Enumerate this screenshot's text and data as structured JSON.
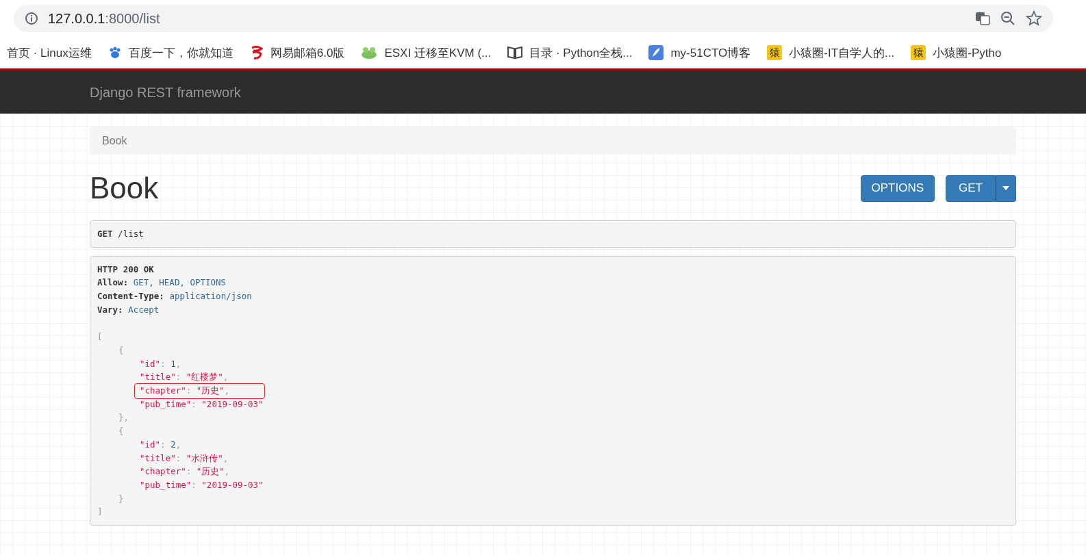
{
  "address_bar": {
    "host": "127.0.0.1",
    "path": ":8000/list"
  },
  "bookmarks": [
    {
      "label": "首页 · Linux运维",
      "kind": "plain"
    },
    {
      "label": "百度一下，你就知道",
      "kind": "paw"
    },
    {
      "label": "网易邮箱6.0版",
      "kind": "mail"
    },
    {
      "label": "ESXI 迁移至KVM (...",
      "kind": "frog"
    },
    {
      "label": "目录 · Python全栈...",
      "kind": "book"
    },
    {
      "label": "my-51CTO博客",
      "kind": "feather"
    },
    {
      "label": "小猿圈-IT自学人的...",
      "kind": "tile",
      "glyph": "猿"
    },
    {
      "label": "小猿圈-Pytho",
      "kind": "tile",
      "glyph": "猿"
    }
  ],
  "navbar": {
    "brand": "Django REST framework"
  },
  "breadcrumb": [
    "Book"
  ],
  "page_title": "Book",
  "buttons": [
    {
      "label": "OPTIONS",
      "kind": "plain"
    },
    {
      "label": "GET",
      "kind": "split"
    }
  ],
  "request": {
    "method": "GET",
    "path": "/list"
  },
  "response": {
    "status": "HTTP 200 OK",
    "headers": [
      {
        "name": "Allow:",
        "value": "GET, HEAD, OPTIONS"
      },
      {
        "name": "Content-Type:",
        "value": "application/json"
      },
      {
        "name": "Vary:",
        "value": "Accept"
      }
    ],
    "open_bracket": "[",
    "records": [
      {
        "open": "{",
        "close": "},",
        "fields": [
          {
            "key": "\"id\"",
            "sep": ":",
            "value": "1",
            "kind": "number",
            "end": ",",
            "highlighted": false
          },
          {
            "key": "\"title\"",
            "sep": ":",
            "value": "\"红楼梦\"",
            "kind": "string",
            "end": ",",
            "highlighted": false
          },
          {
            "key": "\"chapter\"",
            "sep": ":",
            "value": "\"历史\"",
            "kind": "string",
            "end": ",",
            "highlighted": true
          },
          {
            "key": "\"pub_time\"",
            "sep": ":",
            "value": "\"2019-09-03\"",
            "kind": "string",
            "highlighted": false
          }
        ]
      },
      {
        "open": "{",
        "close": "}",
        "fields": [
          {
            "key": "\"id\"",
            "sep": ":",
            "value": "2",
            "kind": "number",
            "end": ",",
            "highlighted": false
          },
          {
            "key": "\"title\"",
            "sep": ":",
            "value": "\"水浒传\"",
            "kind": "string",
            "end": ",",
            "highlighted": false
          },
          {
            "key": "\"chapter\"",
            "sep": ":",
            "value": "\"历史\"",
            "kind": "string",
            "end": ",",
            "highlighted": false
          },
          {
            "key": "\"pub_time\"",
            "sep": ":",
            "value": "\"2019-09-03\"",
            "kind": "string",
            "highlighted": false
          }
        ]
      }
    ],
    "close_bracket": "]"
  }
}
